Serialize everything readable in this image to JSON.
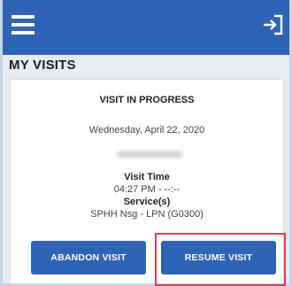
{
  "page": {
    "title": "MY VISITS"
  },
  "topbar": {
    "menu_icon": "hamburger-menu-icon",
    "logout_icon": "logout-icon"
  },
  "visit_card": {
    "heading": "VISIT IN PROGRESS",
    "date": "Wednesday, April 22, 2020",
    "visit_time_label": "Visit Time",
    "visit_time_value": "04:27 PM - --:--",
    "services_label": "Service(s)",
    "service_value": "SPHH Nsg - LPN (G0300)"
  },
  "actions": {
    "abandon_label": "ABANDON VISIT",
    "resume_label": "RESUME VISIT"
  },
  "colors": {
    "brand_blue": "#2f63b6",
    "highlight_red": "#e0404a",
    "background": "#e8ecf1"
  }
}
